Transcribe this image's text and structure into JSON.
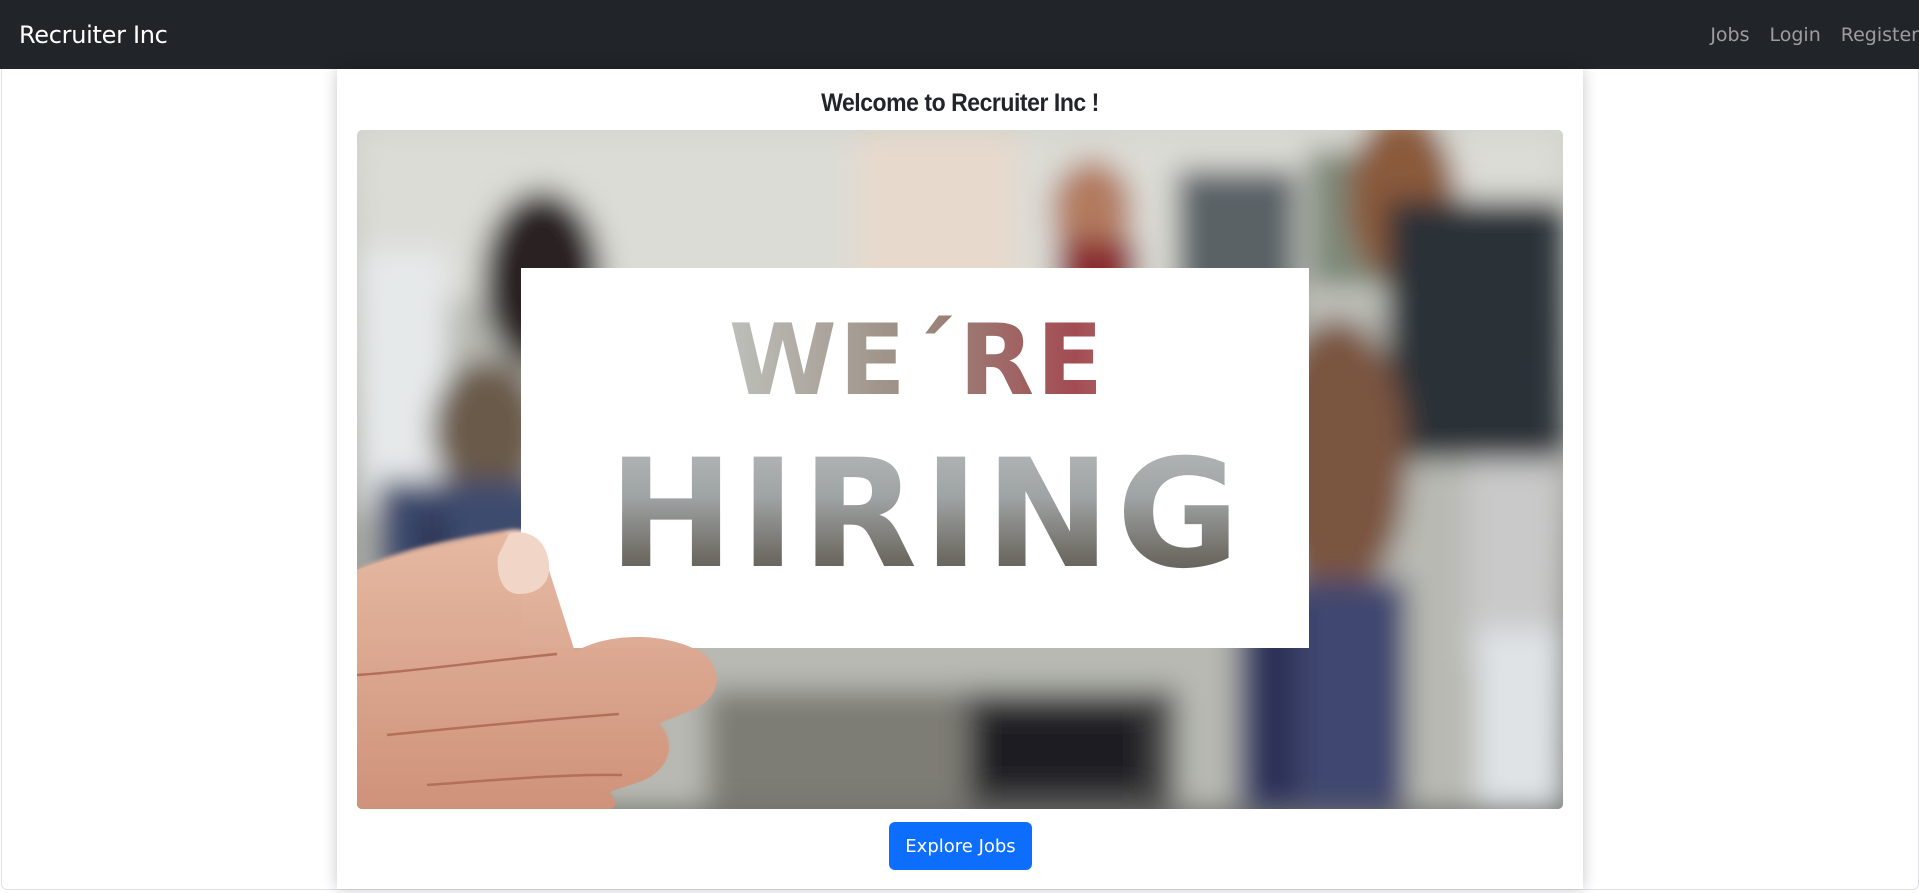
{
  "navbar": {
    "brand": "Recruiter Inc",
    "links": [
      "Jobs",
      "Login",
      "Register"
    ],
    "background": "#212529"
  },
  "main": {
    "title": "Welcome to Recruiter Inc !",
    "hero_image": {
      "line1": "WE´RE",
      "line2": "HIRING"
    },
    "explore_button": "Explore Jobs",
    "accent": "#0d6efd"
  }
}
